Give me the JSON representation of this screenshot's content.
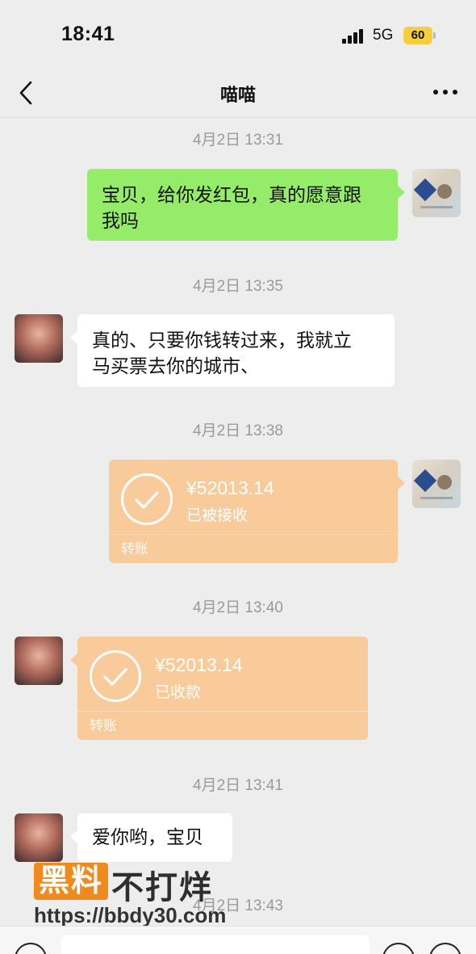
{
  "status_bar": {
    "time": "18:41",
    "network": "5G",
    "battery": "60"
  },
  "nav": {
    "title": "喵喵",
    "back_icon": "chevron-left-icon",
    "more_icon": "more-dots-icon"
  },
  "messages": [
    {
      "type": "timestamp",
      "text": "4月2日 13:31"
    },
    {
      "type": "text",
      "sender": "self",
      "text_line1": "宝贝，给你发红包，真的愿意跟",
      "text_line2": "我吗"
    },
    {
      "type": "timestamp",
      "text": "4月2日 13:35"
    },
    {
      "type": "text",
      "sender": "other",
      "text_line1": "真的、只要你钱转过来，我就立",
      "text_line2": "马买票去你的城市、"
    },
    {
      "type": "timestamp",
      "text": "4月2日 13:38"
    },
    {
      "type": "transfer",
      "sender": "self",
      "amount": "¥52013.14",
      "status": "已被接收",
      "label": "转账"
    },
    {
      "type": "timestamp",
      "text": "4月2日 13:40"
    },
    {
      "type": "transfer",
      "sender": "other",
      "amount": "¥52013.14",
      "status": "已收款",
      "label": "转账"
    },
    {
      "type": "timestamp",
      "text": "4月2日 13:41"
    },
    {
      "type": "text",
      "sender": "other",
      "text_line1": "爱你哟，宝贝"
    },
    {
      "type": "timestamp",
      "text": "4月2日 13:43"
    }
  ],
  "watermark": {
    "badge": "黑料",
    "text": "不打烊",
    "url": "https://bbdy30.com"
  },
  "colors": {
    "background": "#ededed",
    "bubble_self": "#95ec69",
    "bubble_other": "#ffffff",
    "transfer": "#f9cb9b",
    "watermark_orange": "#f08a1c"
  }
}
